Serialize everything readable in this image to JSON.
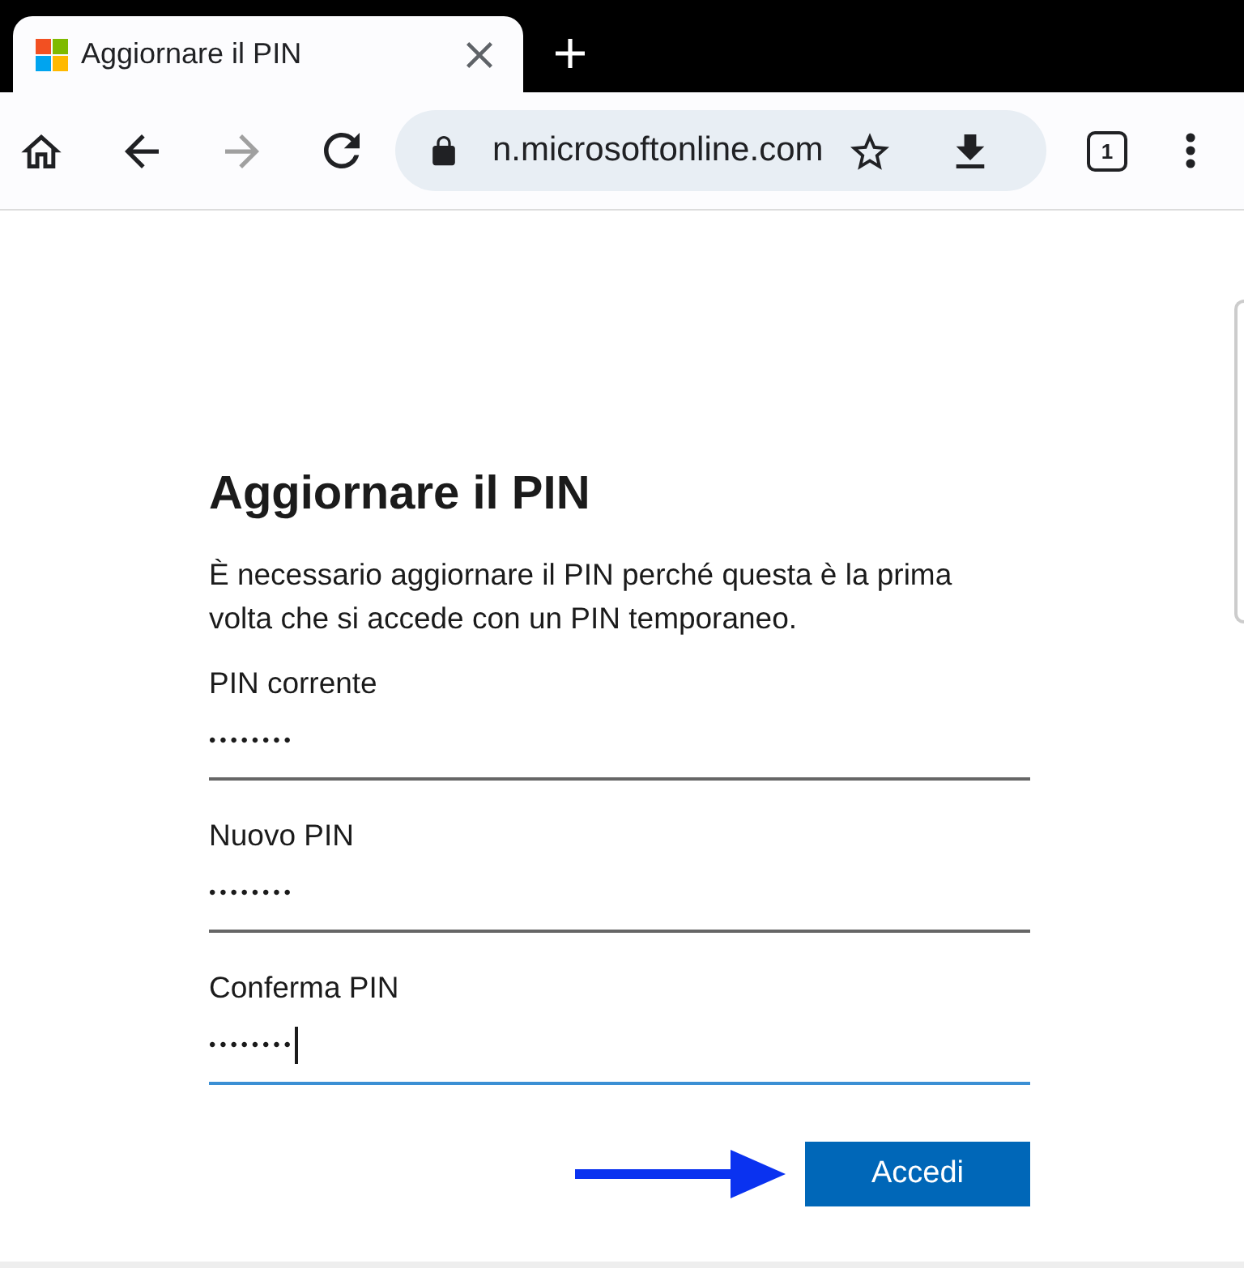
{
  "browser": {
    "tab": {
      "title": "Aggiornare il PIN"
    },
    "toolbar": {
      "forward": {
        "disabled": true
      }
    },
    "address_bar": {
      "url": "n.microsoftonline.com"
    },
    "tab_count": "1"
  },
  "form": {
    "title": "Aggiornare il PIN",
    "description": "È necessario aggiornare il PIN perché questa è la prima volta che si accede con un PIN temporaneo.",
    "fields": [
      {
        "label": "PIN corrente",
        "value": "••••••••",
        "focused": false
      },
      {
        "label": "Nuovo PIN",
        "value": "••••••••",
        "focused": false
      },
      {
        "label": "Conferma PIN",
        "value": "••••••••",
        "focused": true
      }
    ],
    "submit_button": "Accedi"
  }
}
